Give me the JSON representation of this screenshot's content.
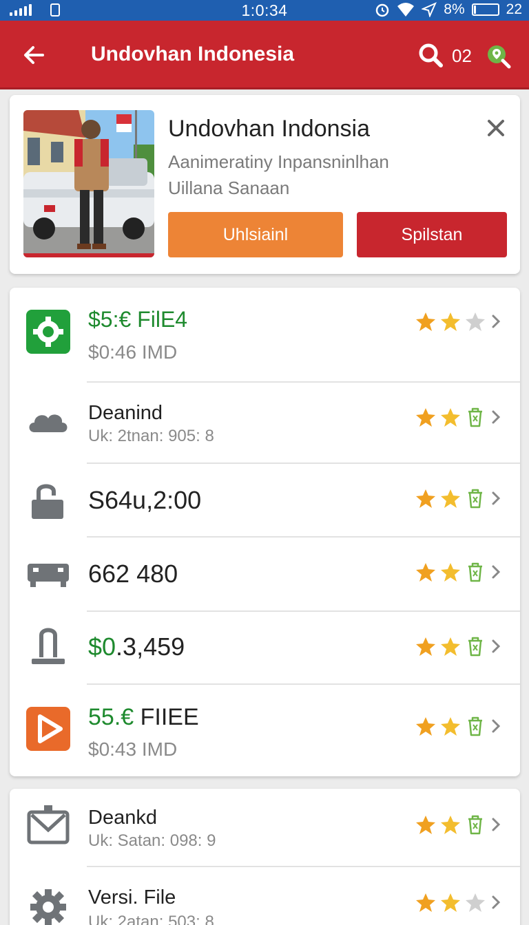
{
  "status_bar": {
    "time": "1:0:34",
    "battery_text": "8%",
    "battery_level": 0.08,
    "extra": "22"
  },
  "app_bar": {
    "title": "Undovhan Indonesia",
    "count": "02"
  },
  "profile": {
    "title": "Undovhan Indonsia",
    "subtitle1": "Aanimeratiny Inpansninlhan",
    "subtitle2": "Uillana Sanaan",
    "primary_button": "Uhlsiainl",
    "secondary_button": "Spilstan"
  },
  "list": [
    {
      "icon": "gear-square-icon",
      "title_a": "$5:€",
      "title_b": "FilE4",
      "sub": "$0:46 IMD",
      "rating": 2,
      "trailing": "star"
    },
    {
      "icon": "cloud-icon",
      "title_a": "",
      "title_b": "Deanind",
      "sub": "Uk: 2tnan: 905: 8",
      "rating": 2,
      "trailing": "trash"
    },
    {
      "icon": "lock-icon",
      "title_a": "",
      "title_b": "S64u,2:00",
      "sub": "",
      "rating": 2,
      "trailing": "trash"
    },
    {
      "icon": "tray-icon",
      "title_a": "",
      "title_b": "662 480",
      "sub": "",
      "rating": 2,
      "trailing": "trash"
    },
    {
      "icon": "plug-icon",
      "title_a": "$0",
      "title_b": ".3,459",
      "sub": "",
      "rating": 2,
      "trailing": "trash"
    },
    {
      "icon": "play-icon",
      "title_a": "55.€",
      "title_b": "FIIEE",
      "sub": "$0:43 IMD",
      "rating": 2,
      "trailing": "trash"
    }
  ],
  "list2": [
    {
      "icon": "mail-check-icon",
      "title_a": "",
      "title_b": "Deankd",
      "sub": "Uk: Satan: 098: 9",
      "rating": 2,
      "trailing": "trash"
    },
    {
      "icon": "gear-icon",
      "title_a": "",
      "title_b": "Versi. File",
      "sub": "Uk: 2atan: 503: 8",
      "rating": 2,
      "trailing": "star"
    }
  ],
  "colors": {
    "status_bar": "#1f5fb0",
    "app_bar": "#c8262e",
    "primary_button": "#ed8436",
    "secondary_button": "#c8262e",
    "accent_green": "#1e8a2e",
    "star": "#f0a020"
  }
}
